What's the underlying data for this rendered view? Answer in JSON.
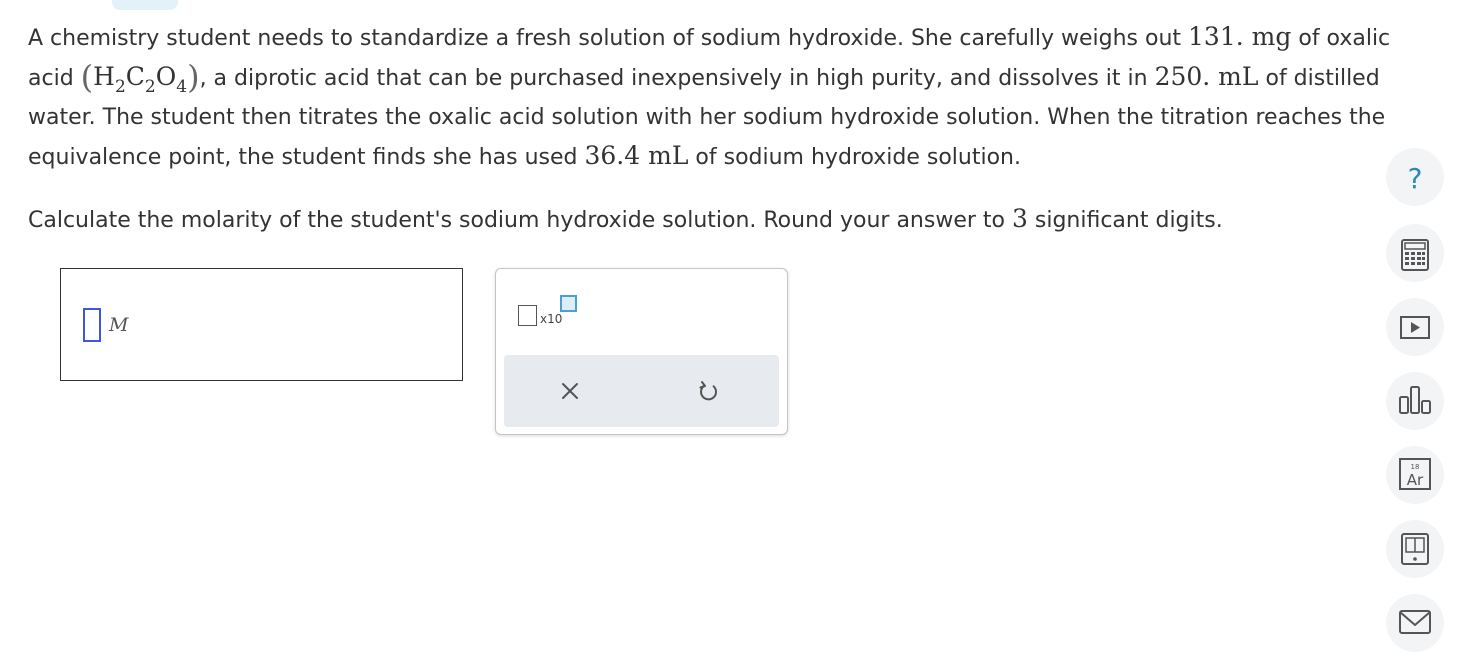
{
  "question": {
    "p1_a": "A chemistry student needs to standardize a fresh solution of sodium hydroxide. She carefully weighs out ",
    "mass": "131. mg",
    "p1_b": " of oxalic acid ",
    "formula": {
      "open": "(",
      "h": "H",
      "h_sub": "2",
      "c": "C",
      "c_sub": "2",
      "o": "O",
      "o_sub": "4",
      "close": ")"
    },
    "p1_c": ", a diprotic acid that can be purchased inexpensively in high purity, and dissolves it in ",
    "volume_water": "250. mL",
    "p1_d": " of distilled water. The student then titrates the oxalic acid solution with her sodium hydroxide solution. When the titration reaches the equivalence point, the student finds she has used ",
    "volume_naoh": "36.4 mL",
    "p1_e": " of sodium hydroxide solution.",
    "p2_a": "Calculate the molarity of the student's sodium hydroxide solution. Round your answer to ",
    "sig_figs": "3",
    "p2_b": " significant digits."
  },
  "answer": {
    "value": "",
    "unit": "M"
  },
  "tools": {
    "sci_notation_label": "x10",
    "clear_label": "×",
    "undo_label": "↺"
  },
  "sidebar": {
    "help_label": "?",
    "periodic_number": "18",
    "periodic_symbol": "Ar"
  },
  "colors": {
    "accent": "#4aa0d6",
    "cursor": "#3d56e6",
    "icon": "#2a8ab6",
    "panel_bar": "#e7eaee"
  }
}
